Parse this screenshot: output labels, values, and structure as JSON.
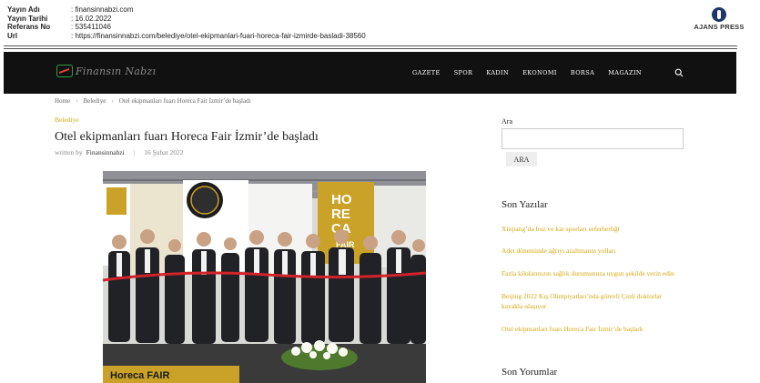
{
  "clipping": {
    "rows": [
      {
        "label": "Yayın Adı",
        "value": ": finansinnabzi.com"
      },
      {
        "label": "Yayın Tarihi",
        "value": ": 16.02.2022"
      },
      {
        "label": "Referans No",
        "value": ": 535411046"
      },
      {
        "label": "Url",
        "value": ": https://finansinnabzi.com/belediye/otel-ekipmanlari-fuari-horeca-fair-izmirde-basladi-38560"
      }
    ],
    "agency": "AJANS PRESS"
  },
  "site": {
    "logo_text": "Finansın Nabzı",
    "nav": [
      "GAZETE",
      "SPOR",
      "KADIN",
      "EKONOMI",
      "BORSA",
      "MAGAZIN"
    ],
    "search_icon": "search-icon"
  },
  "article": {
    "breadcrumb": [
      "Home",
      "Belediye",
      "Otel ekipmanları fuarı Horeca Fair İzmir’de başladı"
    ],
    "category": "Belediye",
    "title": "Otel ekipmanları fuarı Horeca Fair İzmir’de başladı",
    "byline_prefix": "written by",
    "author": "Finansinnabzi",
    "date": "16 Şubat 2022",
    "photo_text": {
      "horeca_1": "HO",
      "horeca_2": "RE",
      "horeca_3": "CA",
      "fair": "FAIR",
      "banner": "Horeca FAIR"
    }
  },
  "sidebar": {
    "search_label": "Ara",
    "search_value": "",
    "search_button": "ARA",
    "recent_heading": "Son Yazılar",
    "recent_posts": [
      "Xinjiang’da buz ve kar sporları seferberliği",
      "Adet döneminde ağrıyı azaltmanın yolları",
      "Fazla kilolarınızın sağlık durumunuza uygun şekilde verin edin",
      "Beijing 2022 Kış Olimpiyatları’nda görevli Çinli doktorlar kayakla ulaşıyor",
      "Otel ekipmanları fuarı Horeca Fair İzmir’de başladı"
    ],
    "comments_heading": "Son Yorumlar"
  },
  "colors": {
    "navbar": "#111111",
    "accent": "#d4a817",
    "logo_green": "#2e9c3f"
  }
}
